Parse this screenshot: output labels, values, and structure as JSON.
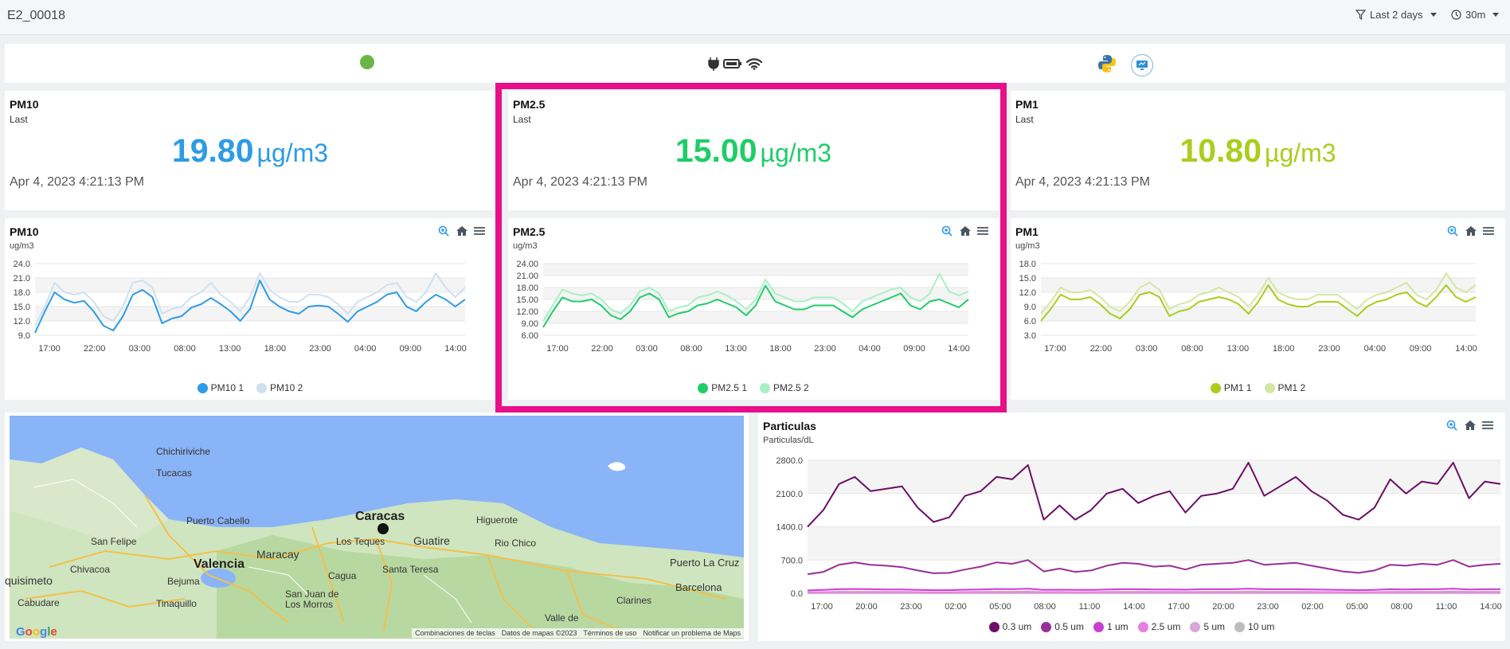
{
  "header": {
    "title": "E2_00018",
    "time_filter": "Last 2 days",
    "refresh": "30m"
  },
  "stats": [
    {
      "title": "PM10",
      "subtitle": "Last",
      "value": "19.80",
      "unit": "µg/m3",
      "timestamp": "Apr 4, 2023 4:21:13 PM",
      "color": "#2e9be6"
    },
    {
      "title": "PM2.5",
      "subtitle": "Last",
      "value": "15.00",
      "unit": "µg/m3",
      "timestamp": "Apr 4, 2023 4:21:13 PM",
      "color": "#1fcd68"
    },
    {
      "title": "PM1",
      "subtitle": "Last",
      "value": "10.80",
      "unit": "µg/m3",
      "timestamp": "Apr 4, 2023 4:21:13 PM",
      "color": "#aacd1e"
    }
  ],
  "map": {
    "labels": [
      "Chichiriviche",
      "Tucacas",
      "Puerto Cabello",
      "San Felipe",
      "Valencia",
      "Maracay",
      "Caracas",
      "Los Teques",
      "Guatire",
      "Higuerote",
      "Rio Chico",
      "Puerto La Cruz",
      "Barcelona",
      "Chivacoa",
      "Bejuma",
      "quisimeto",
      "Cabudare",
      "Tinaquillo",
      "San Juan de Los Morros",
      "Cagua",
      "Santa Teresa",
      "Clarines",
      "Valle de"
    ],
    "footer": [
      "Combinaciones de teclas",
      "Datos de mapas ©2023",
      "Términos de uso",
      "Notificar un problema de Maps"
    ],
    "brand": "Google"
  },
  "chart_data": [
    {
      "type": "line",
      "title": "PM10",
      "ylabel": "ug/m3",
      "x_ticks": [
        "17:00",
        "22:00",
        "03:00",
        "08:00",
        "13:00",
        "18:00",
        "23:00",
        "04:00",
        "09:00",
        "14:00"
      ],
      "y_ticks": [
        "9.0",
        "12.0",
        "15.0",
        "18.0",
        "21.0",
        "24.0"
      ],
      "ylim": [
        9,
        24
      ],
      "series": [
        {
          "name": "PM10 1",
          "color": "#2e9be6",
          "values": [
            9.5,
            14,
            18,
            16.5,
            15.8,
            16.2,
            14,
            11,
            10,
            13,
            17.5,
            18.5,
            17,
            11.5,
            12.5,
            13,
            14.8,
            15.5,
            16.8,
            15.5,
            14,
            12,
            14.5,
            20.5,
            16.5,
            15,
            14,
            13.5,
            15,
            15.2,
            15,
            13.5,
            11.8,
            14,
            15,
            16,
            17.5,
            18,
            15,
            14,
            16,
            17.5,
            16.5,
            15,
            16.5
          ]
        },
        {
          "name": "PM10 2",
          "color": "#cfe0f2",
          "values": [
            11,
            15,
            20,
            18,
            17.5,
            18,
            16,
            13,
            12,
            15,
            20,
            20.5,
            19,
            13.5,
            14.5,
            15,
            17,
            18,
            20,
            17.5,
            16,
            14,
            17,
            22,
            18.5,
            17,
            16,
            16,
            17.5,
            17.5,
            17,
            15.5,
            13.5,
            16,
            17,
            18,
            19.5,
            20,
            17,
            16,
            18,
            22,
            19,
            17,
            19
          ]
        }
      ]
    },
    {
      "type": "line",
      "title": "PM2.5",
      "ylabel": "ug/m3",
      "x_ticks": [
        "17:00",
        "22:00",
        "03:00",
        "08:00",
        "13:00",
        "18:00",
        "23:00",
        "04:00",
        "09:00",
        "14:00"
      ],
      "y_ticks": [
        "6.00",
        "9.00",
        "12.00",
        "15.00",
        "18.00",
        "21.00",
        "24.00"
      ],
      "ylim": [
        6,
        24
      ],
      "series": [
        {
          "name": "PM2.5 1",
          "color": "#1fcd68",
          "values": [
            8,
            12,
            15.5,
            14.5,
            14.5,
            15,
            13.5,
            11,
            10,
            12,
            15.5,
            16.5,
            15,
            10.5,
            11.5,
            12,
            13.5,
            14,
            15,
            14,
            13,
            11,
            13.5,
            18.5,
            14.5,
            13.5,
            12.5,
            12.5,
            13.5,
            13.5,
            13.5,
            12,
            10.5,
            12.5,
            13.5,
            14.5,
            15.5,
            16.5,
            13.5,
            12.5,
            14.5,
            15,
            14,
            13,
            15
          ]
        },
        {
          "name": "PM2.5 2",
          "color": "#a6f0c4",
          "values": [
            9.5,
            13.5,
            17.5,
            16.5,
            16,
            16.5,
            15,
            12.5,
            11.5,
            13.5,
            17,
            18,
            16.5,
            12,
            13,
            13.5,
            15.5,
            16,
            17,
            16,
            14.5,
            12.5,
            15,
            20,
            16.5,
            15.5,
            14.5,
            14.5,
            15.5,
            15.5,
            15.5,
            14,
            12,
            14.5,
            15.5,
            16.5,
            17.5,
            18,
            15.5,
            14.5,
            16.5,
            21.5,
            17,
            16,
            17
          ]
        }
      ]
    },
    {
      "type": "line",
      "title": "PM1",
      "ylabel": "ug/m3",
      "x_ticks": [
        "17:00",
        "22:00",
        "03:00",
        "08:00",
        "13:00",
        "18:00",
        "23:00",
        "04:00",
        "09:00",
        "14:00"
      ],
      "y_ticks": [
        "3.0",
        "6.0",
        "9.0",
        "12.0",
        "15.0",
        "18.0"
      ],
      "ylim": [
        3,
        18
      ],
      "series": [
        {
          "name": "PM1 1",
          "color": "#aacd1e",
          "values": [
            6,
            8.5,
            11.5,
            10.5,
            10.5,
            11,
            9.5,
            7.5,
            6.5,
            8.5,
            11.5,
            12,
            11,
            7,
            8,
            8.5,
            10,
            10.5,
            11,
            10.5,
            9.5,
            7.5,
            10,
            13.5,
            10.5,
            9.5,
            9,
            9,
            10,
            10,
            10,
            8.5,
            7,
            9,
            10,
            10.5,
            11.5,
            12,
            10,
            9,
            11,
            13.5,
            11,
            10,
            11
          ]
        },
        {
          "name": "PM1 2",
          "color": "#d6e6a4",
          "values": [
            7.5,
            10,
            13,
            12,
            12,
            12.5,
            11,
            9,
            8,
            10,
            13,
            14,
            12.5,
            8.5,
            9.5,
            10,
            11.5,
            12,
            13,
            12,
            11,
            9,
            11.5,
            15,
            12,
            11,
            10.5,
            10.5,
            11.5,
            11.5,
            11.5,
            10,
            8.5,
            10.5,
            11.5,
            12,
            13,
            14,
            11.5,
            10.5,
            12.5,
            16,
            13,
            12,
            13.5
          ]
        }
      ]
    },
    {
      "type": "line",
      "title": "Particulas",
      "ylabel": "Particulas/dL",
      "x_ticks": [
        "17:00",
        "20:00",
        "23:00",
        "02:00",
        "05:00",
        "08:00",
        "11:00",
        "14:00",
        "17:00",
        "20:00",
        "23:00",
        "02:00",
        "05:00",
        "08:00",
        "11:00",
        "14:00"
      ],
      "y_ticks": [
        "0.0",
        "700.0",
        "1400.0",
        "2100.0",
        "2800.0"
      ],
      "ylim": [
        0,
        2800
      ],
      "series": [
        {
          "name": "0.3 um",
          "color": "#6b0f67",
          "values": [
            1400,
            1750,
            2300,
            2450,
            2150,
            2200,
            2250,
            1800,
            1500,
            1600,
            2050,
            2150,
            2450,
            2400,
            2700,
            1550,
            1850,
            1550,
            1750,
            2100,
            2200,
            1900,
            2050,
            2150,
            1700,
            2050,
            2100,
            2200,
            2750,
            2050,
            2250,
            2450,
            2150,
            1950,
            1650,
            1550,
            1800,
            2400,
            2100,
            2350,
            2300,
            2750,
            2000,
            2350,
            2300
          ]
        },
        {
          "name": "0.5 um",
          "color": "#9a2d97",
          "values": [
            400,
            450,
            600,
            650,
            600,
            580,
            550,
            480,
            420,
            430,
            500,
            560,
            650,
            620,
            700,
            460,
            520,
            450,
            480,
            580,
            640,
            620,
            560,
            580,
            500,
            600,
            620,
            640,
            700,
            600,
            620,
            640,
            580,
            520,
            460,
            430,
            480,
            600,
            580,
            620,
            600,
            700,
            560,
            600,
            620
          ]
        },
        {
          "name": "1 um",
          "color": "#c93fd1",
          "values": [
            60,
            70,
            85,
            90,
            85,
            80,
            80,
            70,
            65,
            65,
            75,
            80,
            90,
            85,
            95,
            70,
            75,
            70,
            70,
            80,
            85,
            85,
            80,
            80,
            75,
            85,
            85,
            85,
            95,
            85,
            85,
            85,
            80,
            75,
            70,
            65,
            70,
            85,
            80,
            85,
            85,
            95,
            80,
            85,
            85
          ]
        },
        {
          "name": "2.5 um",
          "color": "#e67ee6",
          "values": [
            20,
            25,
            30,
            30,
            30,
            30,
            28,
            25,
            22,
            22,
            26,
            28,
            30,
            30,
            32,
            25,
            26,
            24,
            25,
            28,
            30,
            30,
            28,
            28,
            26,
            30,
            30,
            30,
            32,
            30,
            30,
            30,
            28,
            26,
            25,
            23,
            25,
            30,
            28,
            30,
            30,
            32,
            28,
            30,
            30
          ]
        },
        {
          "name": "5 um",
          "color": "#d9a6d9",
          "values": [
            5,
            6,
            7,
            7,
            7,
            7,
            6,
            6,
            5,
            5,
            6,
            7,
            7,
            7,
            8,
            6,
            6,
            6,
            6,
            7,
            7,
            7,
            7,
            7,
            6,
            7,
            7,
            7,
            8,
            7,
            7,
            7,
            7,
            6,
            6,
            5,
            6,
            7,
            7,
            7,
            7,
            8,
            7,
            7,
            7
          ]
        },
        {
          "name": "10 um",
          "color": "#bdbdbd",
          "values": [
            1,
            1,
            1,
            1,
            1,
            1,
            1,
            1,
            1,
            1,
            1,
            1,
            1,
            1,
            1,
            1,
            1,
            1,
            1,
            1,
            1,
            1,
            1,
            1,
            1,
            1,
            1,
            1,
            1,
            1,
            1,
            1,
            1,
            1,
            1,
            1,
            1,
            1,
            1,
            1,
            1,
            1,
            1,
            1,
            1
          ]
        }
      ]
    }
  ]
}
